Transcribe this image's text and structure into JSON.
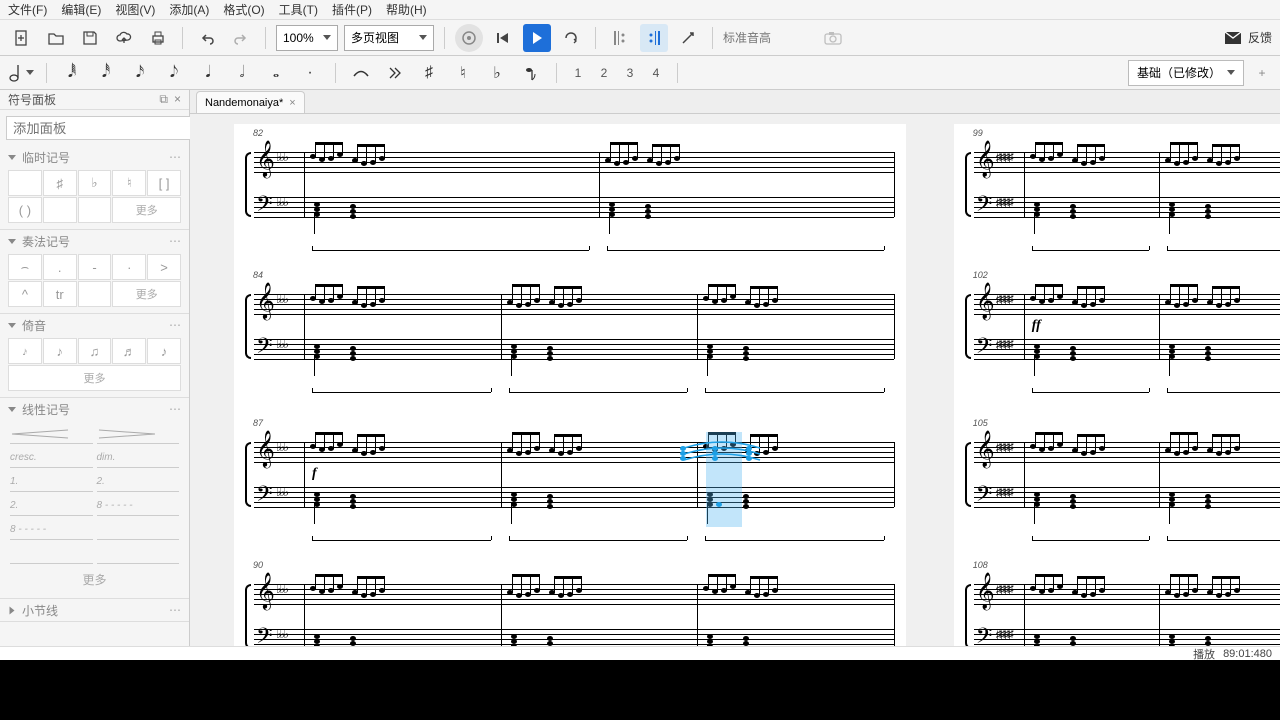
{
  "menu": {
    "file": "文件(F)",
    "edit": "编辑(E)",
    "view": "视图(V)",
    "add": "添加(A)",
    "format": "格式(O)",
    "tools": "工具(T)",
    "plugins": "插件(P)",
    "help": "帮助(H)"
  },
  "toolbar": {
    "zoom": "100%",
    "view_mode": "多页视图",
    "pitch_placeholder": "标准音高",
    "feedback_label": "反馈"
  },
  "note_bar": {
    "voices": [
      "1",
      "2",
      "3",
      "4"
    ],
    "workspace_label": "基础（已修改）"
  },
  "sidebar": {
    "title": "符号面板",
    "search_placeholder": "添加面板",
    "sections": {
      "accidentals": {
        "label": "临时记号",
        "cells": [
          "",
          "♯",
          "♭",
          "♮",
          "[ ]"
        ],
        "paren": "( )",
        "more": "更多"
      },
      "articulations": {
        "label": "奏法记号",
        "cells": [
          "⌢",
          ".",
          "-",
          "·",
          ">",
          "^",
          "tr",
          ""
        ],
        "more": "更多"
      },
      "grace": {
        "label": "倚音",
        "more": "更多"
      },
      "lines": {
        "label": "线性记号",
        "items": [
          "",
          "",
          "cresc.",
          "dim.",
          "1.",
          "2.",
          "2.",
          "8 - - - - -",
          "8 - - - - -",
          "",
          "",
          ""
        ],
        "more": "更多"
      },
      "barlines": {
        "label": "小节线"
      }
    }
  },
  "tab": {
    "title": "Nandemonaiya*"
  },
  "score": {
    "left_measures": [
      "82",
      "84",
      "87",
      "90"
    ],
    "right_measures": [
      "99",
      "102",
      "105",
      "108"
    ],
    "dynamic_f": "f",
    "dynamic_ff": "ff"
  },
  "status": {
    "label": "播放",
    "time": "89:01:480"
  }
}
